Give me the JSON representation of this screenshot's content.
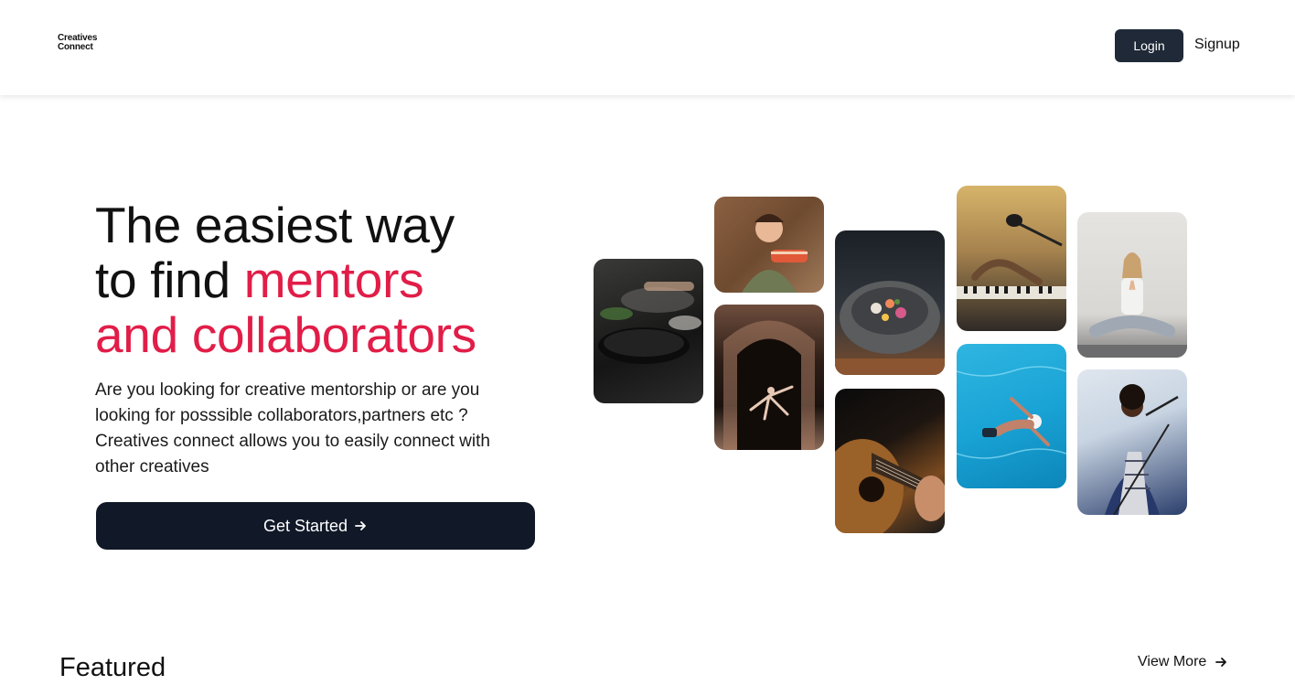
{
  "header": {
    "logo": {
      "tagline": "",
      "line1": "Creatives",
      "line2": "Connect"
    },
    "login_label": "Login",
    "signup_label": "Signup"
  },
  "hero": {
    "title_line1": "The easiest way",
    "title_line2_prefix": "to find ",
    "title_line2_accent": "mentors",
    "title_line3_accent": "and collaborators",
    "description": "Are you looking for creative mentorship or are you looking for posssible collaborators,partners etc ? Creatives connect allows you to easily connect with other creatives",
    "cta_label": "Get Started",
    "accent_color": "#e11d48"
  },
  "mosaic": {
    "tiles": [
      "cooking-photo",
      "baker-photo",
      "dancer-photo",
      "food-bowl-photo",
      "guitar-photo",
      "piano-photo",
      "swimmer-photo",
      "yoga-photo",
      "singer-photo"
    ]
  },
  "featured": {
    "heading": "Featured",
    "view_more_label": "View More"
  },
  "colors": {
    "primary_dark": "#111827",
    "login_bg": "#1f2937",
    "accent": "#e11d48"
  },
  "icons": {
    "cta": "arrow-right-icon",
    "view_more": "arrow-right-icon"
  }
}
